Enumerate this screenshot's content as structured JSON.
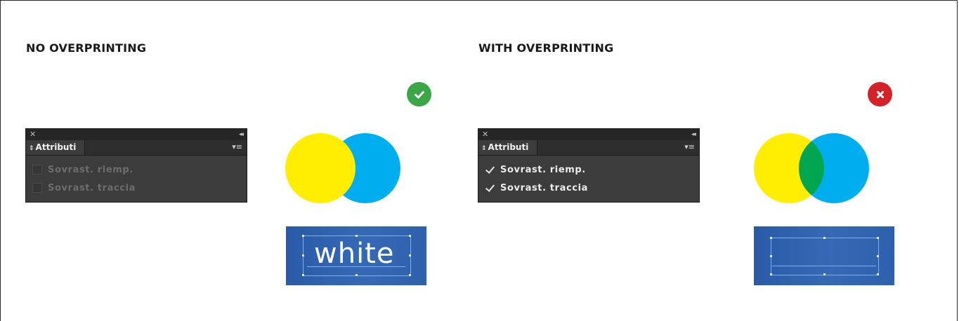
{
  "left": {
    "heading": "NO OVERPRINTING",
    "status_icon": "check-circle-icon",
    "status_color": "#3aa646",
    "panel": {
      "title": "Attributi",
      "close_glyph": "✕",
      "collapse_glyph": "◂◂",
      "menu_glyph": "▾≡",
      "options": [
        {
          "label": "Sovrast. riemp.",
          "checked": false
        },
        {
          "label": "Sovrast. traccia",
          "checked": false
        }
      ]
    },
    "circle_colors": {
      "yellow": "#ffee00",
      "cyan": "#00aeef",
      "overlap": "#00aeef"
    },
    "text_sample": "white"
  },
  "right": {
    "heading": "WITH OVERPRINTING",
    "status_icon": "x-circle-icon",
    "status_color": "#d2232a",
    "panel": {
      "title": "Attributi",
      "close_glyph": "✕",
      "collapse_glyph": "◂◂",
      "menu_glyph": "▾≡",
      "options": [
        {
          "label": "Sovrast. riemp.",
          "checked": true
        },
        {
          "label": "Sovrast. traccia",
          "checked": true
        }
      ]
    },
    "circle_colors": {
      "yellow": "#ffee00",
      "cyan": "#00aeef",
      "overlap": "#00a650"
    },
    "text_sample": ""
  }
}
